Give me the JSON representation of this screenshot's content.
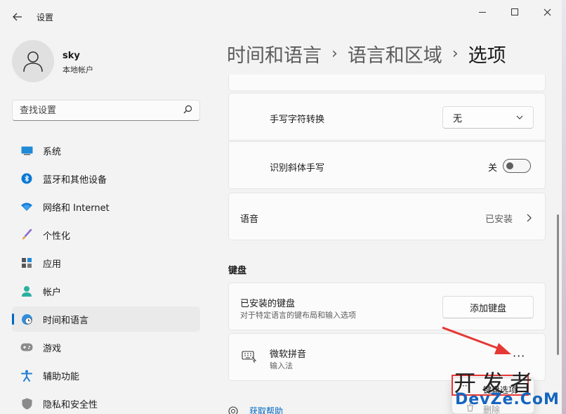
{
  "window": {
    "title": "设置"
  },
  "user": {
    "name": "sky",
    "account_type": "本地帐户"
  },
  "search": {
    "placeholder": "查找设置"
  },
  "sidebar": {
    "items": [
      {
        "label": "系统",
        "icon": "monitor-icon"
      },
      {
        "label": "蓝牙和其他设备",
        "icon": "bluetooth-icon"
      },
      {
        "label": "网络和 Internet",
        "icon": "wifi-icon"
      },
      {
        "label": "个性化",
        "icon": "brush-icon"
      },
      {
        "label": "应用",
        "icon": "apps-icon"
      },
      {
        "label": "帐户",
        "icon": "person-icon"
      },
      {
        "label": "时间和语言",
        "icon": "globe-clock-icon",
        "active": true
      },
      {
        "label": "游戏",
        "icon": "gamepad-icon"
      },
      {
        "label": "辅助功能",
        "icon": "accessibility-icon"
      },
      {
        "label": "隐私和安全性",
        "icon": "shield-icon"
      }
    ]
  },
  "breadcrumb": {
    "level1": "时间和语言",
    "level2": "语言和区域",
    "current": "选项",
    "separator": "›"
  },
  "handwriting": {
    "convert_label": "手写字符转换",
    "convert_value": "无",
    "italic_label": "识别斜体手写",
    "italic_state": "关"
  },
  "speech": {
    "label": "语音",
    "status": "已安装"
  },
  "keyboard": {
    "section_title": "键盘",
    "installed_title": "已安装的键盘",
    "installed_desc": "对于特定语言的键布局和输入选项",
    "add_button": "添加键盘",
    "ime_name": "微软拼音",
    "ime_type": "输入法",
    "more_label": "···"
  },
  "context_menu": {
    "options_label": "键盘选项",
    "delete_label": "删除",
    "more": "···"
  },
  "help": {
    "label": "获取帮助"
  },
  "watermark": {
    "top": "开发者",
    "bottom": "DevZe.CoM"
  },
  "colors": {
    "accent": "#0067c0",
    "highlight": "#e53935",
    "arrow": "#e53935"
  }
}
